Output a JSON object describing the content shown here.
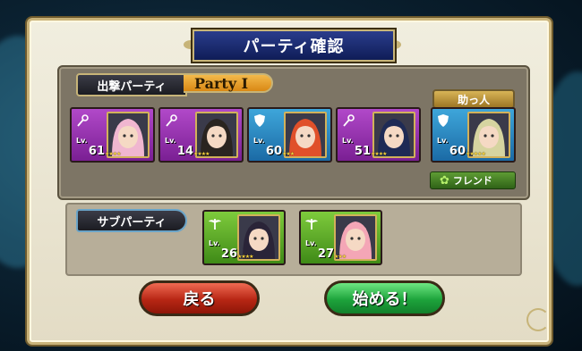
{
  "title": "パーティ確認",
  "main_party": {
    "label": "出撃パーティ",
    "name": "Party I",
    "members": [
      {
        "class_icon": "staff-icon",
        "color": "purple",
        "level_label": "Lv.",
        "level": "61",
        "stars": "★★★★",
        "hair": "#f0b6d0"
      },
      {
        "class_icon": "staff-icon",
        "color": "purple",
        "level_label": "Lv.",
        "level": "14",
        "stars": "★★★★",
        "hair": "#2a2420"
      },
      {
        "class_icon": "shield-icon",
        "color": "blue",
        "level_label": "Lv.",
        "level": "60",
        "stars": "★★★",
        "hair": "#e0502a"
      },
      {
        "class_icon": "staff-icon",
        "color": "purple",
        "level_label": "Lv.",
        "level": "51",
        "stars": "★★★★",
        "hair": "#1e2a55"
      }
    ]
  },
  "helper": {
    "label": "助っ人",
    "member": {
      "class_icon": "shield-icon",
      "color": "blue",
      "level_label": "Lv.",
      "level": "60",
      "stars": "★★★★★",
      "hair": "#d6d4a0"
    },
    "badge_label": "フレンド",
    "badge_icon": "clover-icon"
  },
  "sub_party": {
    "label": "サブパーティ",
    "members": [
      {
        "class_icon": "winged-staff-icon",
        "color": "green",
        "level_label": "Lv.",
        "level": "26",
        "stars": "★★★★",
        "hair": "#2a2438"
      },
      {
        "class_icon": "winged-staff-icon",
        "color": "green",
        "level_label": "Lv.",
        "level": "27",
        "stars": "★★★",
        "hair": "#f4a6b6"
      }
    ]
  },
  "buttons": {
    "back_label": "戻る",
    "start_label": "始める！"
  }
}
